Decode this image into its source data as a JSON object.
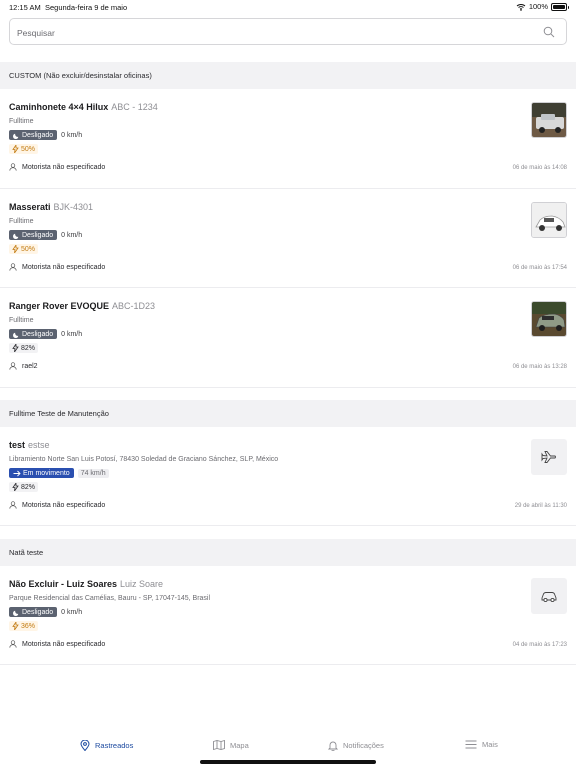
{
  "status_bar": {
    "time": "12:15 AM",
    "date": "Segunda-feira 9 de maio",
    "battery": "100%"
  },
  "search": {
    "placeholder": "Pesquisar"
  },
  "sections": [
    {
      "title": "CUSTOM (Não excluir/desinstalar oficinas)",
      "items": [
        {
          "name": "Caminhonete 4×4 Hilux",
          "plate": "ABC - 1234",
          "subtitle": "Fulltime",
          "status": "Desligado",
          "speed": "0 km/h",
          "battery": "50%",
          "driver": "Motorista não especificado",
          "timestamp": "06 de maio às 14:08",
          "thumbnail": "pickup-truck-photo"
        },
        {
          "name": "Masserati",
          "plate": "BJK-4301",
          "subtitle": "Fulltime",
          "status": "Desligado",
          "speed": "0 km/h",
          "battery": "50%",
          "driver": "Motorista não especificado",
          "timestamp": "06 de maio às 17:54",
          "thumbnail": "sedan-photo"
        },
        {
          "name": "Ranger Rover EVOQUE",
          "plate": "ABC-1D23",
          "subtitle": "Fulltime",
          "status": "Desligado",
          "speed": "0 km/h",
          "battery": "82%",
          "driver": "rael2",
          "timestamp": "06 de maio às 13:28",
          "thumbnail": "suv-photo"
        }
      ]
    },
    {
      "title": "Fulltime Teste de Manutenção",
      "items": [
        {
          "name": "test",
          "plate": "estse",
          "subtitle": "Libramiento Norte San Luis Potosí, 78430 Soledad de Graciano Sánchez, SLP, México",
          "status": "Em movimento",
          "speed": "74 km/h",
          "battery": "82%",
          "driver": "Motorista não especificado",
          "timestamp": "29 de abril às 11:30",
          "thumbnail": "airplane-icon"
        }
      ]
    },
    {
      "title": "Natã teste",
      "items": [
        {
          "name": "Não Excluir - Luiz Soares",
          "plate": "Luiz Soare",
          "subtitle": "Parque Residencial das Camélias, Bauru - SP, 17047-145, Brasil",
          "status": "Desligado",
          "speed": "0 km/h",
          "battery": "36%",
          "driver": "Motorista não especificado",
          "timestamp": "04 de maio às 17:23",
          "thumbnail": "car-icon"
        }
      ]
    }
  ],
  "tabbar": {
    "tabs": [
      {
        "label": "Rastreados",
        "icon": "location-pin-icon",
        "active": true
      },
      {
        "label": "Mapa",
        "icon": "map-icon",
        "active": false
      },
      {
        "label": "Notificações",
        "icon": "bell-icon",
        "active": false
      },
      {
        "label": "Mais",
        "icon": "menu-icon",
        "active": false
      }
    ]
  },
  "colors": {
    "accent": "#1c4aa0",
    "off_badge": "#5b6270",
    "moving_badge": "#2a4fb0",
    "battery_low": "#c27b12"
  }
}
